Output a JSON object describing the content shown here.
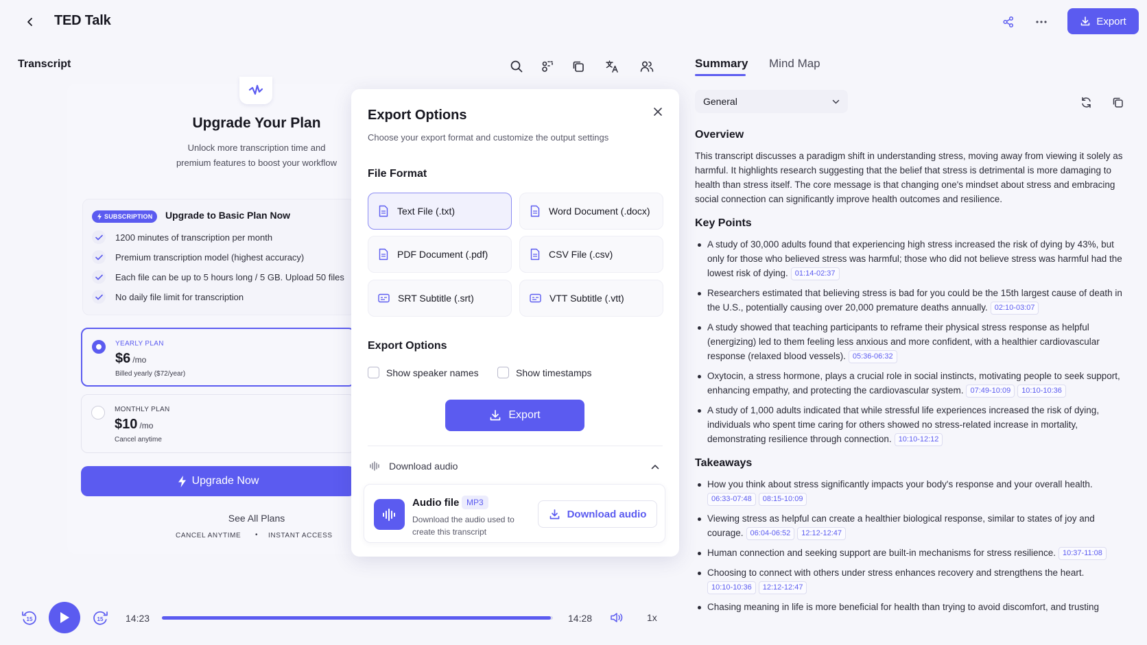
{
  "header": {
    "title": "TED Talk",
    "export_label": "Export"
  },
  "transcript": {
    "label": "Transcript"
  },
  "upgrade": {
    "title": "Upgrade Your Plan",
    "subtitle": "Unlock more transcription time and premium features to boost your workflow",
    "badge": "SUBSCRIPTION",
    "heading": "Upgrade to Basic Plan Now",
    "features": [
      "1200 minutes of transcription per month",
      "Premium transcription model (highest accuracy)",
      "Each file can be up to 5 hours long / 5 GB. Upload 50 files",
      "No daily file limit for transcription"
    ],
    "plans": [
      {
        "name": "YEARLY PLAN",
        "price": "$6",
        "unit": "/mo",
        "note": "Billed yearly ($72/year)",
        "selected": true
      },
      {
        "name": "MONTHLY PLAN",
        "price": "$10",
        "unit": "/mo",
        "note": "Cancel anytime",
        "selected": false
      }
    ],
    "cta": "Upgrade Now",
    "see_all": "See All Plans",
    "cancel_anytime": "CANCEL ANYTIME",
    "separator": "•",
    "instant_access": "INSTANT ACCESS"
  },
  "export_modal": {
    "title": "Export Options",
    "subtitle": "Choose your export format and customize the output settings",
    "file_format_heading": "File Format",
    "formats": [
      {
        "label": "Text File (.txt)",
        "selected": true
      },
      {
        "label": "Word Document (.docx)",
        "selected": false
      },
      {
        "label": "PDF Document (.pdf)",
        "selected": false
      },
      {
        "label": "CSV File (.csv)",
        "selected": false
      },
      {
        "label": "SRT Subtitle (.srt)",
        "selected": false
      },
      {
        "label": "VTT Subtitle (.vtt)",
        "selected": false
      }
    ],
    "options_heading": "Export Options",
    "options": [
      {
        "label": "Show speaker names",
        "checked": false
      },
      {
        "label": "Show timestamps",
        "checked": false
      }
    ],
    "export_button": "Export",
    "download_section": "Download audio",
    "audio": {
      "title": "Audio file",
      "badge": "MP3",
      "description": "Download the audio used to create this transcript",
      "button": "Download audio"
    }
  },
  "player": {
    "current_time": "14:23",
    "duration": "14:28",
    "progress": 0.994,
    "speed": "1x"
  },
  "summary_panel": {
    "tabs": [
      "Summary",
      "Mind Map"
    ],
    "active_tab": "Summary",
    "select_value": "General",
    "overview_heading": "Overview",
    "overview": "This transcript discusses a paradigm shift in understanding stress, moving away from viewing it solely as harmful. It highlights research suggesting that the belief that stress is detrimental is more damaging to health than stress itself. The core message is that changing one's mindset about stress and embracing social connection can significantly improve health outcomes and resilience.",
    "key_points_heading": "Key Points",
    "key_points": [
      {
        "text": "A study of 30,000 adults found that experiencing high stress increased the risk of dying by 43%, but only for those who believed stress was harmful; those who did not believe stress was harmful had the lowest risk of dying.",
        "timestamps": [
          "01:14-02:37"
        ]
      },
      {
        "text": "Researchers estimated that believing stress is bad for you could be the 15th largest cause of death in the U.S., potentially causing over 20,000 premature deaths annually.",
        "timestamps": [
          "02:10-03:07"
        ]
      },
      {
        "text": "A study showed that teaching participants to reframe their physical stress response as helpful (energizing) led to them feeling less anxious and more confident, with a healthier cardiovascular response (relaxed blood vessels).",
        "timestamps": [
          "05:36-06:32"
        ]
      },
      {
        "text": "Oxytocin, a stress hormone, plays a crucial role in social instincts, motivating people to seek support, enhancing empathy, and protecting the cardiovascular system.",
        "timestamps": [
          "07:49-10:09",
          "10:10-10:36"
        ]
      },
      {
        "text": "A study of 1,000 adults indicated that while stressful life experiences increased the risk of dying, individuals who spent time caring for others showed no stress-related increase in mortality, demonstrating resilience through connection.",
        "timestamps": [
          "10:10-12:12"
        ]
      }
    ],
    "takeaways_heading": "Takeaways",
    "takeaways": [
      {
        "text": "How you think about stress significantly impacts your body's response and your overall health.",
        "timestamps": [
          "06:33-07:48",
          "08:15-10:09"
        ]
      },
      {
        "text": "Viewing stress as helpful can create a healthier biological response, similar to states of joy and courage.",
        "timestamps": [
          "06:04-06:52",
          "12:12-12:47"
        ]
      },
      {
        "text": "Human connection and seeking support are built-in mechanisms for stress resilience.",
        "timestamps": [
          "10:37-11:08"
        ]
      },
      {
        "text": "Choosing to connect with others under stress enhances recovery and strengthens the heart.",
        "timestamps": [
          "10:10-10:36",
          "12:12-12:47"
        ]
      },
      {
        "text": "Chasing meaning in life is more beneficial for health than trying to avoid discomfort, and trusting",
        "timestamps": []
      }
    ]
  },
  "colors": {
    "accent": "#5b5bf0",
    "background": "#f6f6fb"
  }
}
